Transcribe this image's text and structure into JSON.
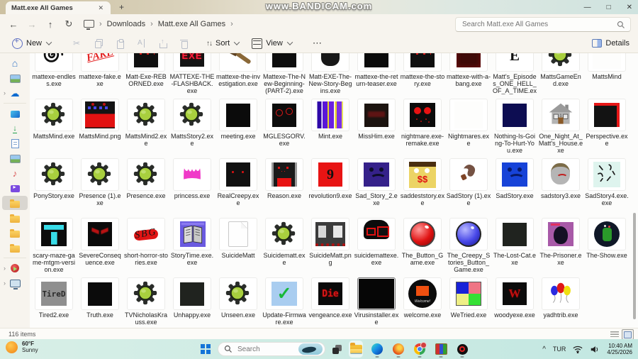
{
  "window": {
    "tab_title": "Matt.exe All Games",
    "new_tab": "+",
    "close_tab": "✕",
    "watermark": "www.BANDICAM.com",
    "controls": {
      "minimize": "—",
      "maximize": "□",
      "close": "✕"
    }
  },
  "nav": {
    "back": "←",
    "forward": "→",
    "up": "↑",
    "refresh": "↻",
    "sep": "›",
    "crumb1": "Downloads",
    "crumb2": "Matt.exe All Games",
    "search_placeholder": "Search Matt.exe All Games"
  },
  "toolbar": {
    "new_label": "New",
    "sort_label": "Sort",
    "view_label": "View",
    "more": "⋯",
    "details_label": "Details",
    "sort_icon": "↑↓",
    "cut_icon": "✂"
  },
  "sidebar": {
    "items": [
      {
        "id": "home"
      },
      {
        "id": "gallery"
      },
      {
        "id": "onedrive",
        "chevron": true
      },
      {
        "divider": true
      },
      {
        "id": "desktop"
      },
      {
        "id": "downloads"
      },
      {
        "id": "documents"
      },
      {
        "id": "pictures"
      },
      {
        "id": "music"
      },
      {
        "id": "videos"
      },
      {
        "id": "folder",
        "selected": true
      },
      {
        "id": "folder2"
      },
      {
        "id": "folder3"
      },
      {
        "id": "folder4"
      },
      {
        "divider": true
      },
      {
        "id": "media",
        "chevron": true
      },
      {
        "id": "thispc",
        "chevron": true
      }
    ]
  },
  "files": {
    "items": [
      {
        "name": "mattexe-endless.exe",
        "icon": "spiral"
      },
      {
        "name": "mattexe-fake.exe",
        "icon": "fake",
        "icon_text": "FAKE"
      },
      {
        "name": "Matt-Exe-REBORNED.exe",
        "icon": "drip"
      },
      {
        "name": "MATTEXE-THE-FLASHBACK.exe",
        "icon": "exe-red",
        "icon_text": "EXE"
      },
      {
        "name": "mattexe-the-investigation.exe",
        "icon": "axe"
      },
      {
        "name": "Mattexe-The-New-Beginning-(PART-2).exe",
        "icon": "red-eyes"
      },
      {
        "name": "Matt-EXE-The-New-Story-Begins.exe",
        "icon": "creature"
      },
      {
        "name": "mattexe-the-return-teaser.exe",
        "icon": "black"
      },
      {
        "name": "mattexe-the-story.exe",
        "icon": "drip"
      },
      {
        "name": "mattexe-with-a-bang.exe",
        "icon": "maroon"
      },
      {
        "name": "Matt's_Episodes_ONE_HELL_OF_A_TIME.exe",
        "icon": "letter",
        "icon_text": "E"
      },
      {
        "name": "MattsGameEnd.exe",
        "icon": "gear"
      },
      {
        "name": "MattsMind",
        "icon": "blank"
      },
      {
        "name": "MattsMind.exe",
        "icon": "gear"
      },
      {
        "name": "MattsMind.png",
        "icon": "pixel"
      },
      {
        "name": "MattsMind2.exe",
        "icon": "gear"
      },
      {
        "name": "MattsStory2.exe",
        "icon": "gear"
      },
      {
        "name": "meeting.exe",
        "icon": "black"
      },
      {
        "name": "MGLESGORV.exe",
        "icon": "ring-eyes"
      },
      {
        "name": "Mint.exe",
        "icon": "stripes"
      },
      {
        "name": "MissHim.exe",
        "icon": "misshim"
      },
      {
        "name": "nightmare.exe-remake.exe",
        "icon": "big-red-eyes"
      },
      {
        "name": "Nightmares.exe",
        "icon": "blank"
      },
      {
        "name": "Nothing-Is-Going-To-Hurt-You.exe",
        "icon": "navy"
      },
      {
        "name": "One_Night_At_Matt's_House.exe",
        "icon": "house"
      },
      {
        "name": "Perspective.exe",
        "icon": "perspective"
      },
      {
        "name": "PonyStory.exe",
        "icon": "gear"
      },
      {
        "name": "Presence (1).exe",
        "icon": "gear"
      },
      {
        "name": "Presence.exe",
        "icon": "gear"
      },
      {
        "name": "princess.exe",
        "icon": "crown"
      },
      {
        "name": "RealCreepy.exe",
        "icon": "dot-eyes"
      },
      {
        "name": "Reason.exe",
        "icon": "monster"
      },
      {
        "name": "revolution9.exe",
        "icon": "nine",
        "icon_text": "9"
      },
      {
        "name": "Sad_Story_2.exe",
        "icon": "sad-indigo"
      },
      {
        "name": "saddeststory.exe",
        "icon": "crying-yellow",
        "icon_text": "$$"
      },
      {
        "name": "SadStory (1).exe",
        "icon": "blob"
      },
      {
        "name": "SadStory.exe",
        "icon": "sad-blue"
      },
      {
        "name": "sadstory3.exe",
        "icon": "crying-gray"
      },
      {
        "name": "SadStory4.exe.exe",
        "icon": "squiggles"
      },
      {
        "name": "scary-maze-game-mtgm-version.exe",
        "icon": "maze"
      },
      {
        "name": "SevereConsequence.exe",
        "icon": "evil-eyes"
      },
      {
        "name": "short-horror-stories.exe",
        "icon": "sbg",
        "icon_text": "SBG"
      },
      {
        "name": "StoryTime.exe.exe",
        "icon": "book"
      },
      {
        "name": "SuicideMatt",
        "icon": "page"
      },
      {
        "name": "Suicidematt.exe",
        "icon": "gear"
      },
      {
        "name": "SuicideMatt.png",
        "icon": "panels"
      },
      {
        "name": "suicidemattexe.exe",
        "icon": "gray-face"
      },
      {
        "name": "The_Button_Game.exe",
        "icon": "red-button"
      },
      {
        "name": "The_Creepy_Stories_Button_Game.exe",
        "icon": "blue-button"
      },
      {
        "name": "The-Lost-Cat.exe",
        "icon": "dark"
      },
      {
        "name": "The-Prisoner.exe",
        "icon": "prisoner"
      },
      {
        "name": "The-Show.exe",
        "icon": "show"
      },
      {
        "name": "Tired2.exe",
        "icon": "tired",
        "icon_text": "TireD"
      },
      {
        "name": "Truth.exe",
        "icon": "black"
      },
      {
        "name": "TVNicholasKrauss.exe",
        "icon": "gear"
      },
      {
        "name": "Unhappy.exe",
        "icon": "dark"
      },
      {
        "name": "Unseen.exe",
        "icon": "gear"
      },
      {
        "name": "Update-Firmware.exe",
        "icon": "check",
        "icon_text": "✓"
      },
      {
        "name": "vengeance.exe",
        "icon": "die",
        "icon_text": "Die"
      },
      {
        "name": "Virusinstaller.exe",
        "icon": "virus",
        "selected": true
      },
      {
        "name": "welcome.exe",
        "icon": "welcome",
        "icon_text": "Welcome!"
      },
      {
        "name": "WeTried.exe",
        "icon": "quads"
      },
      {
        "name": "woodyexe.exe",
        "icon": "woody",
        "icon_text": "W"
      },
      {
        "name": "yadhtrib.exe",
        "icon": "balloons"
      }
    ]
  },
  "status": {
    "items_count": "116 items"
  },
  "taskbar": {
    "weather_temp": "60°F",
    "weather_cond": "Sunny",
    "search_placeholder": "Search",
    "tray_chevron": "^",
    "tray_lang": "TUR",
    "tray_time": "10:40 AM",
    "tray_date": "4/25/2026"
  }
}
